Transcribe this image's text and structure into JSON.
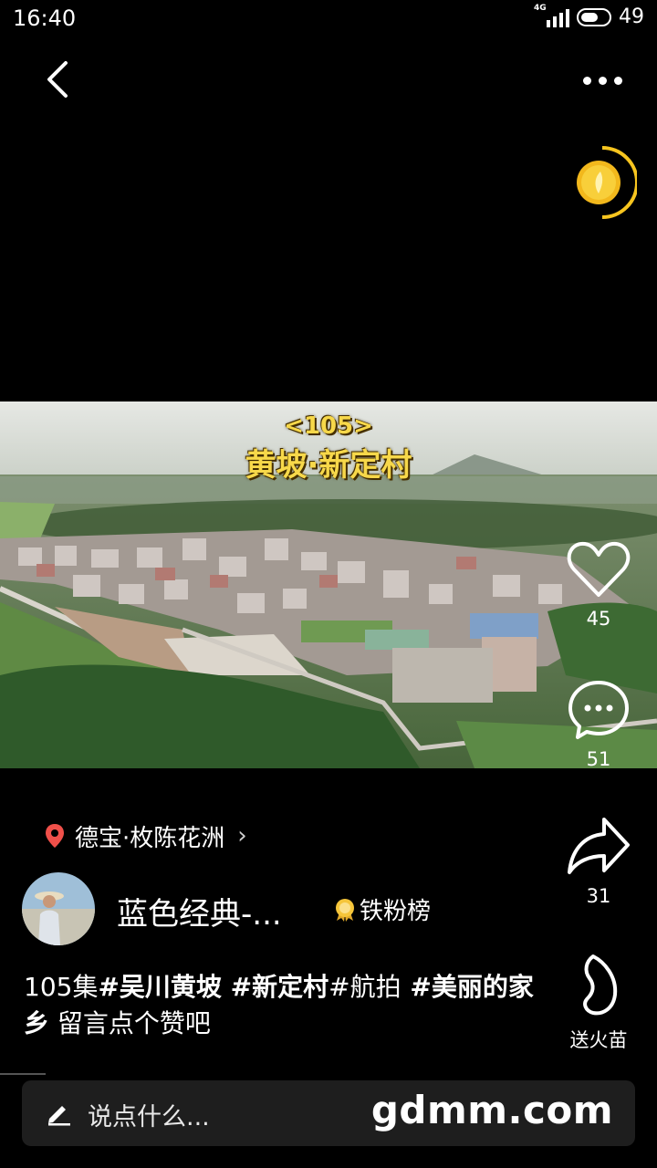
{
  "status": {
    "time": "16:40",
    "network": "4G",
    "battery": "49"
  },
  "video": {
    "episode_label": "<105>",
    "title_overlay": "黄坡·新定村"
  },
  "actions": {
    "like_count": "45",
    "comment_count": "51",
    "share_count": "31",
    "gift_label": "送火苗"
  },
  "location": {
    "label": "德宝·枚陈花洲"
  },
  "author": {
    "name": "蓝色经典-...",
    "fan_rank_label": "铁粉榜"
  },
  "description": {
    "prefix": "105集",
    "tag1": "#吴川黄坡",
    "tag2": " #新定村",
    "mid": "#航拍",
    "tag3": " #美丽的家乡",
    "suffix": " 留言点个赞吧"
  },
  "comment_bar": {
    "placeholder": "说点什么..."
  },
  "watermark": "gdmm.com",
  "colors": {
    "accent_gold": "#f7c51f",
    "location_pin": "#f0504a",
    "caption_yellow": "#f7d84a"
  }
}
